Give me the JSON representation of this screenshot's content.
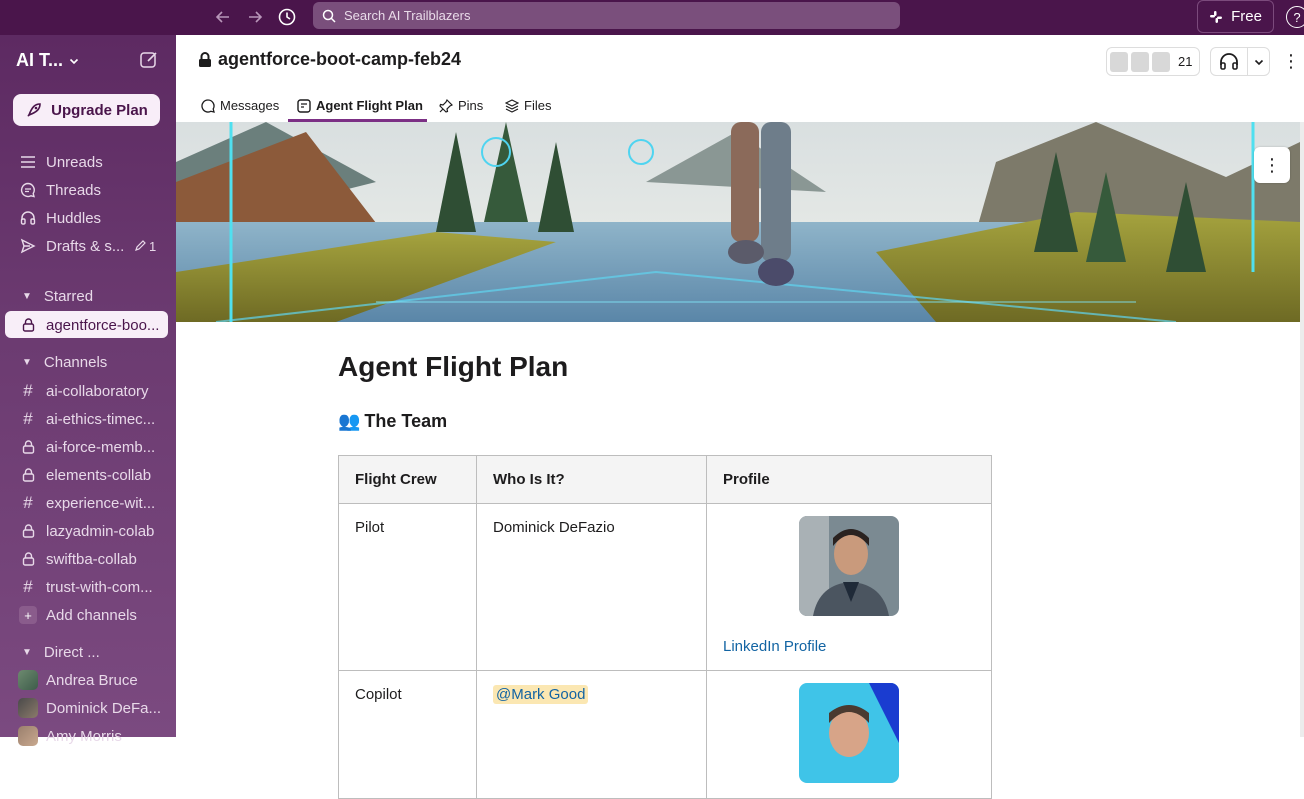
{
  "topbar": {
    "search_placeholder": "Search AI Trailblazers",
    "plan_label": "Free",
    "help_label": "?"
  },
  "sidebar": {
    "workspace_name": "AI T...",
    "upgrade_label": "Upgrade Plan",
    "nav": [
      {
        "label": "Unreads",
        "icon": "unreads-icon"
      },
      {
        "label": "Threads",
        "icon": "threads-icon"
      },
      {
        "label": "Huddles",
        "icon": "headphones-icon"
      },
      {
        "label": "Drafts & s...",
        "icon": "send-icon",
        "count": "1"
      }
    ],
    "starred_header": "Starred",
    "starred": [
      {
        "label": "agentforce-boo...",
        "icon": "lock-icon"
      }
    ],
    "channels_header": "Channels",
    "channels": [
      {
        "label": "ai-collaboratory",
        "icon": "hash-icon"
      },
      {
        "label": "ai-ethics-timec...",
        "icon": "hash-icon"
      },
      {
        "label": "ai-force-memb...",
        "icon": "lock-icon"
      },
      {
        "label": "elements-collab",
        "icon": "lock-icon"
      },
      {
        "label": "experience-wit...",
        "icon": "hash-icon"
      },
      {
        "label": "lazyadmin-colab",
        "icon": "lock-icon"
      },
      {
        "label": "swiftba-collab",
        "icon": "lock-icon"
      },
      {
        "label": "trust-with-com...",
        "icon": "hash-icon"
      }
    ],
    "add_channels": "Add channels",
    "dm_header": "Direct ...",
    "dms": [
      {
        "label": "Andrea Bruce"
      },
      {
        "label": "Dominick DeFa..."
      },
      {
        "label": "Amy Morris"
      }
    ]
  },
  "header": {
    "channel_name": "agentforce-boot-camp-feb24",
    "member_count": "21"
  },
  "tabs": [
    {
      "label": "Messages",
      "icon": "message-icon"
    },
    {
      "label": "Agent Flight Plan",
      "icon": "canvas-icon",
      "active": true
    },
    {
      "label": "Pins",
      "icon": "pin-icon"
    },
    {
      "label": "Files",
      "icon": "layers-icon"
    }
  ],
  "canvas": {
    "title": "Agent Flight Plan",
    "team_emoji": "👥",
    "team_heading": "The Team",
    "table": {
      "headers": [
        "Flight Crew",
        "Who Is It?",
        "Profile"
      ],
      "rows": [
        {
          "role": "Pilot",
          "who": "Dominick DeFazio",
          "profile_link": "LinkedIn Profile"
        },
        {
          "role": "Copilot",
          "who": "@Mark Good",
          "profile_link": ""
        }
      ]
    }
  },
  "colors": {
    "topbar": "#4a154b",
    "sidebar": "#6b3a70",
    "accent": "#7c3085",
    "link": "#1264a3",
    "mention_bg": "#fbe7b2"
  }
}
